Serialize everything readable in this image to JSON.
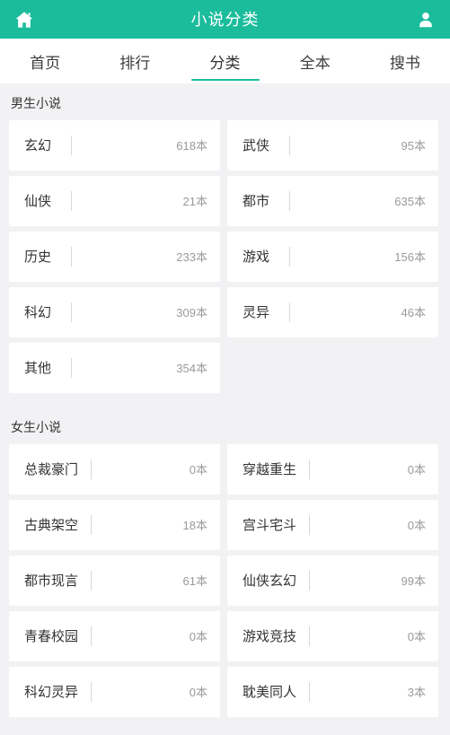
{
  "header": {
    "title": "小说分类",
    "home_icon": "home-icon",
    "user_icon": "user-icon",
    "background_color": "#1abc9c",
    "title_color": "#ffffff"
  },
  "tabs": [
    {
      "label": "首页",
      "active": false
    },
    {
      "label": "排行",
      "active": false
    },
    {
      "label": "分类",
      "active": true
    },
    {
      "label": "全本",
      "active": false
    },
    {
      "label": "搜书",
      "active": false
    }
  ],
  "accent_color": "#1abc9c",
  "sections": [
    {
      "title": "男生小说",
      "categories": [
        {
          "name": "玄幻",
          "count": "618本"
        },
        {
          "name": "武侠",
          "count": "95本"
        },
        {
          "name": "仙侠",
          "count": "21本"
        },
        {
          "name": "都市",
          "count": "635本"
        },
        {
          "name": "历史",
          "count": "233本"
        },
        {
          "name": "游戏",
          "count": "156本"
        },
        {
          "name": "科幻",
          "count": "309本"
        },
        {
          "name": "灵异",
          "count": "46本"
        },
        {
          "name": "其他",
          "count": "354本"
        }
      ]
    },
    {
      "title": "女生小说",
      "categories": [
        {
          "name": "总裁豪门",
          "count": "0本"
        },
        {
          "name": "穿越重生",
          "count": "0本"
        },
        {
          "name": "古典架空",
          "count": "18本"
        },
        {
          "name": "宫斗宅斗",
          "count": "0本"
        },
        {
          "name": "都市现言",
          "count": "61本"
        },
        {
          "name": "仙侠玄幻",
          "count": "99本"
        },
        {
          "name": "青春校园",
          "count": "0本"
        },
        {
          "name": "游戏竞技",
          "count": "0本"
        },
        {
          "name": "科幻灵异",
          "count": "0本"
        },
        {
          "name": "耽美同人",
          "count": "3本"
        }
      ]
    }
  ]
}
